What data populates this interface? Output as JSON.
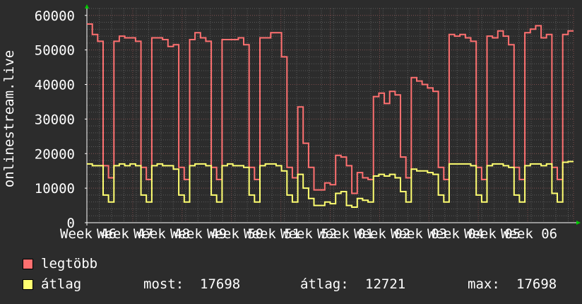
{
  "chart_data": {
    "type": "line",
    "ylabel": "onlinestream.live",
    "ylim": [
      0,
      62000
    ],
    "yticks": [
      0,
      10000,
      20000,
      30000,
      40000,
      50000,
      60000
    ],
    "ytick_labels": [
      "0",
      "10000",
      "20000",
      "30000",
      "40000",
      "50000",
      "60000"
    ],
    "xlim": [
      0,
      69
    ],
    "xtick_positions": [
      0,
      6.5,
      13.5,
      20.5,
      27.5,
      34.5,
      41.5,
      48.5,
      55.5,
      62.5,
      69
    ],
    "xtick_labels": [
      "Week 46",
      "Week 47",
      "Week 48",
      "Week 49",
      "Week 50",
      "Week 51",
      "Week 52",
      "Week 01",
      "Week 02",
      "Week 03",
      "Week 04",
      "Week 05",
      "Week 06"
    ],
    "grid": true,
    "colors": {
      "legtobb": "#ff7070",
      "atlag": "#ffff70",
      "background": "#2c2c2c",
      "grid": "#5a5a5a",
      "text": "#ffffff"
    },
    "series": [
      {
        "name": "legtöbb",
        "color": "#ff7070",
        "values": [
          57500,
          54500,
          52500,
          16500,
          13000,
          52500,
          54000,
          53500,
          53500,
          52500,
          16000,
          12500,
          53500,
          53500,
          53000,
          51000,
          51500,
          16000,
          12500,
          53000,
          55000,
          53500,
          52500,
          16000,
          12500,
          53000,
          53000,
          53000,
          53500,
          51500,
          16000,
          12500,
          53500,
          53500,
          55000,
          55000,
          48000,
          16000,
          13000,
          33500,
          23000,
          16000,
          9500,
          9500,
          11500,
          11000,
          19500,
          19000,
          16500,
          8500,
          14500,
          13000,
          12500,
          36500,
          37500,
          34500,
          38000,
          37000,
          19000,
          13000,
          42000,
          41000,
          40000,
          39000,
          38000,
          16000,
          12500,
          54500,
          54000,
          54500,
          53500,
          52500,
          16000,
          12500,
          54000,
          53500,
          55500,
          54000,
          51500,
          16000,
          12500,
          55000,
          56000,
          57000,
          53500,
          54500,
          16000,
          12500,
          54500,
          55500
        ]
      },
      {
        "name": "átlag",
        "color": "#ffff70",
        "values": [
          17000,
          16500,
          16500,
          8000,
          6000,
          16500,
          17000,
          16500,
          17000,
          16500,
          8000,
          6000,
          16500,
          17000,
          16500,
          16500,
          15500,
          8000,
          6000,
          16500,
          17000,
          17000,
          16500,
          8000,
          6000,
          16500,
          17000,
          16500,
          16500,
          16000,
          8000,
          6000,
          16500,
          17000,
          17000,
          16500,
          15000,
          8000,
          6000,
          14000,
          10000,
          7000,
          5000,
          5000,
          6000,
          5500,
          8500,
          9000,
          5000,
          4500,
          7000,
          6500,
          6000,
          13500,
          14000,
          13500,
          14000,
          13000,
          9000,
          6000,
          15500,
          15000,
          15000,
          14500,
          14000,
          8000,
          6000,
          17000,
          17000,
          17000,
          17000,
          16500,
          8000,
          6000,
          16500,
          17000,
          17000,
          16500,
          16000,
          8000,
          6000,
          16500,
          17000,
          17000,
          16500,
          17000,
          8500,
          6000,
          17500,
          17698
        ]
      }
    ]
  },
  "legend": {
    "items": [
      {
        "label": "legtöbb",
        "color": "#ff7070"
      },
      {
        "label": "átlag",
        "color": "#ffff70"
      }
    ],
    "stats": {
      "most_label": "most:",
      "most_value": "17698",
      "atlag_label": "átlag:",
      "atlag_value": "12721",
      "max_label": "max:",
      "max_value": "17698"
    }
  }
}
